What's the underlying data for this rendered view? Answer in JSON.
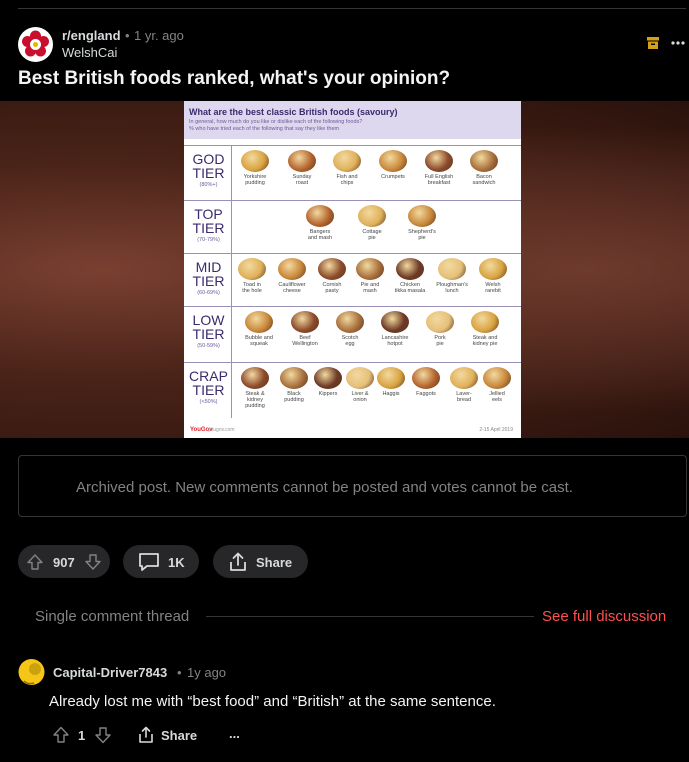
{
  "post": {
    "subreddit": "r/england",
    "separator": "•",
    "time": "1 yr. ago",
    "author": "WelshCai",
    "title": "Best British foods ranked, what's your opinion?",
    "upvotes": "907",
    "comments": "1K",
    "share_label": "Share"
  },
  "chart": {
    "title": "What are the best classic British foods (savoury)",
    "subtitle_1": "In general, how much do you like or dislike each of the following foods?",
    "subtitle_2": "% who have tried each of the following that say they like them",
    "brand": "YouGov",
    "url": "yougov.com",
    "date": "2-15 April 2019",
    "tiers": [
      {
        "name": "GOD\nTIER",
        "pct": "(80%+)",
        "foods": [
          "Yorkshire\npudding",
          "Sunday\nroast",
          "Fish and\nchips",
          "Crumpets",
          "Full English\nbreakfast",
          "Bacon\nsandwich"
        ]
      },
      {
        "name": "TOP\nTIER",
        "pct": "(70-79%)",
        "foods": [
          "Bangers\nand mash",
          "Cottage\npie",
          "Shepherd's\npie"
        ]
      },
      {
        "name": "MID\nTIER",
        "pct": "(60-69%)",
        "foods": [
          "Toad in\nthe hole",
          "Cauliflower\ncheese",
          "Cornish\npasty",
          "Pie and\nmash",
          "Chicken\ntikka masala",
          "Ploughman's\nlunch",
          "Welsh\nrarebit"
        ]
      },
      {
        "name": "LOW\nTIER",
        "pct": "(50-59%)",
        "foods": [
          "Bubble and\nsqueak",
          "Beef\nWellington",
          "Scotch\negg",
          "Lancashire\nhotpot",
          "Pork\npie",
          "Steak and\nkidney pie"
        ]
      },
      {
        "name": "CRAP\nTIER",
        "pct": "(<50%)",
        "foods": [
          "Steak &\nkidney\npudding",
          "Black\npudding",
          "Kippers",
          "Liver &\nonion",
          "Haggis",
          "Faggots",
          "Laver-\nbread",
          "Jellied\neels"
        ]
      }
    ]
  },
  "archived_notice": "Archived post. New comments cannot be posted and votes cannot be cast.",
  "thread": {
    "label": "Single comment thread",
    "see_full": "See full discussion"
  },
  "comment": {
    "author": "Capital-Driver7843",
    "separator": "•",
    "time": "1y ago",
    "body": "Already lost me with “best food” and “British” at the same sentence.",
    "votes": "1",
    "share_label": "Share",
    "more": "..."
  },
  "colors": {
    "background": "#000000",
    "accent_link": "#ff4f4f",
    "pill": "#272729",
    "archive_icon": "#d4a017"
  }
}
